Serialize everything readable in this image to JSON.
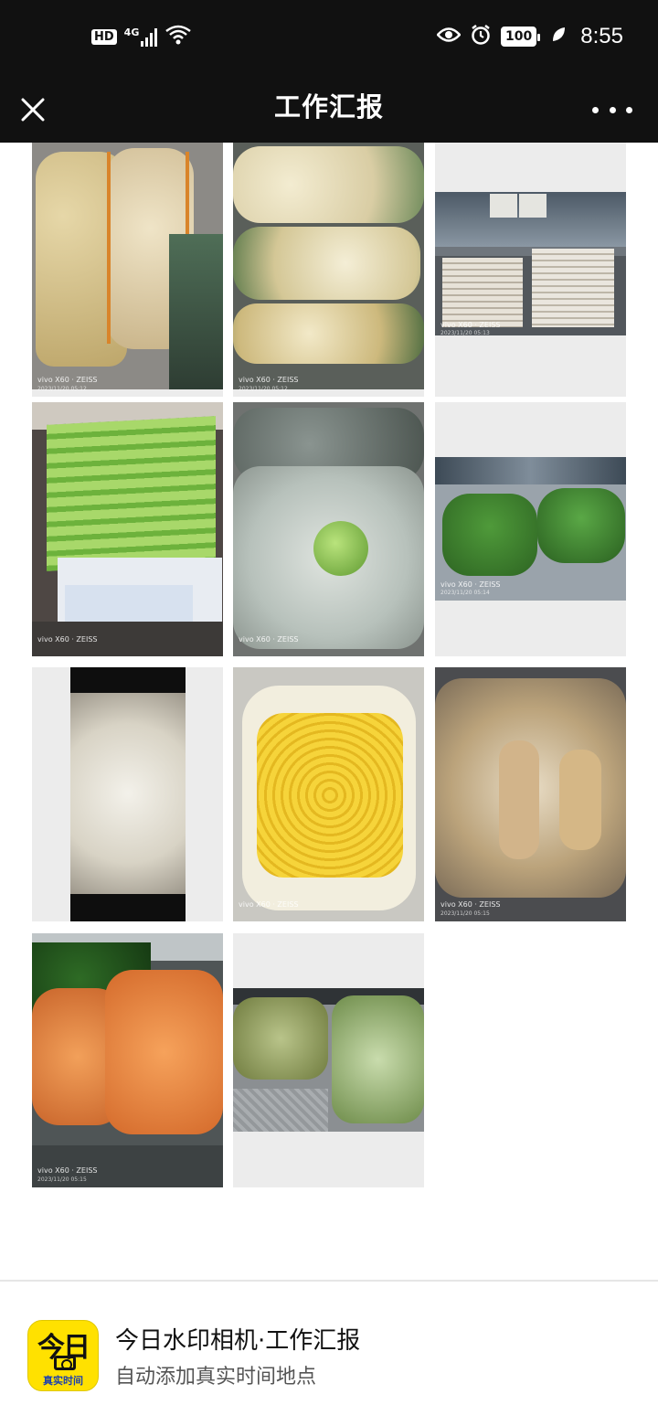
{
  "status_bar": {
    "hd_label": "HD",
    "network_label": "4G",
    "battery_level": "100",
    "time": "8:55",
    "icons": [
      "signal-icon",
      "wifi-icon",
      "eye-icon",
      "alarm-icon",
      "battery-icon",
      "leaf-icon"
    ]
  },
  "header": {
    "title": "工作汇报",
    "close_icon": "close-icon",
    "more_icon": "more-icon"
  },
  "photos": [
    {
      "subject": "potatoes",
      "watermark": "vivo X60 · ZEISS",
      "watermark_date": "2023/11/20 05:12"
    },
    {
      "subject": "cauliflower",
      "watermark": "vivo X60 · ZEISS",
      "watermark_date": "2023/11/20 05:12"
    },
    {
      "subject": "tofu-trays",
      "watermark": "vivo X60 · ZEISS",
      "watermark_date": "2023/11/20 05:13"
    },
    {
      "subject": "celery",
      "watermark": "vivo X60 · ZEISS",
      "watermark_date": ""
    },
    {
      "subject": "cabbage",
      "watermark": "vivo X60 · ZEISS",
      "watermark_date": ""
    },
    {
      "subject": "leafy-greens",
      "watermark": "vivo X60 · ZEISS",
      "watermark_date": "2023/11/20 05:14"
    },
    {
      "subject": "mushrooms",
      "watermark": "",
      "watermark_date": ""
    },
    {
      "subject": "corn",
      "watermark": "vivo X60 · ZEISS",
      "watermark_date": ""
    },
    {
      "subject": "lotus-root",
      "watermark": "vivo X60 · ZEISS",
      "watermark_date": "2023/11/20 05:15"
    },
    {
      "subject": "carrots",
      "watermark": "vivo X60 · ZEISS",
      "watermark_date": "2023/11/20 05:15"
    },
    {
      "subject": "lettuce",
      "watermark": "",
      "watermark_date": ""
    }
  ],
  "footer": {
    "app_icon_big": "今日",
    "app_icon_small": "真实时间",
    "app_name": "今日水印相机·工作汇报",
    "app_tagline": "自动添加真实时间地点"
  },
  "colors": {
    "bar_background": "#111111",
    "icon_yellow": "#ffe100",
    "icon_blue_text": "#1a3fb0"
  }
}
